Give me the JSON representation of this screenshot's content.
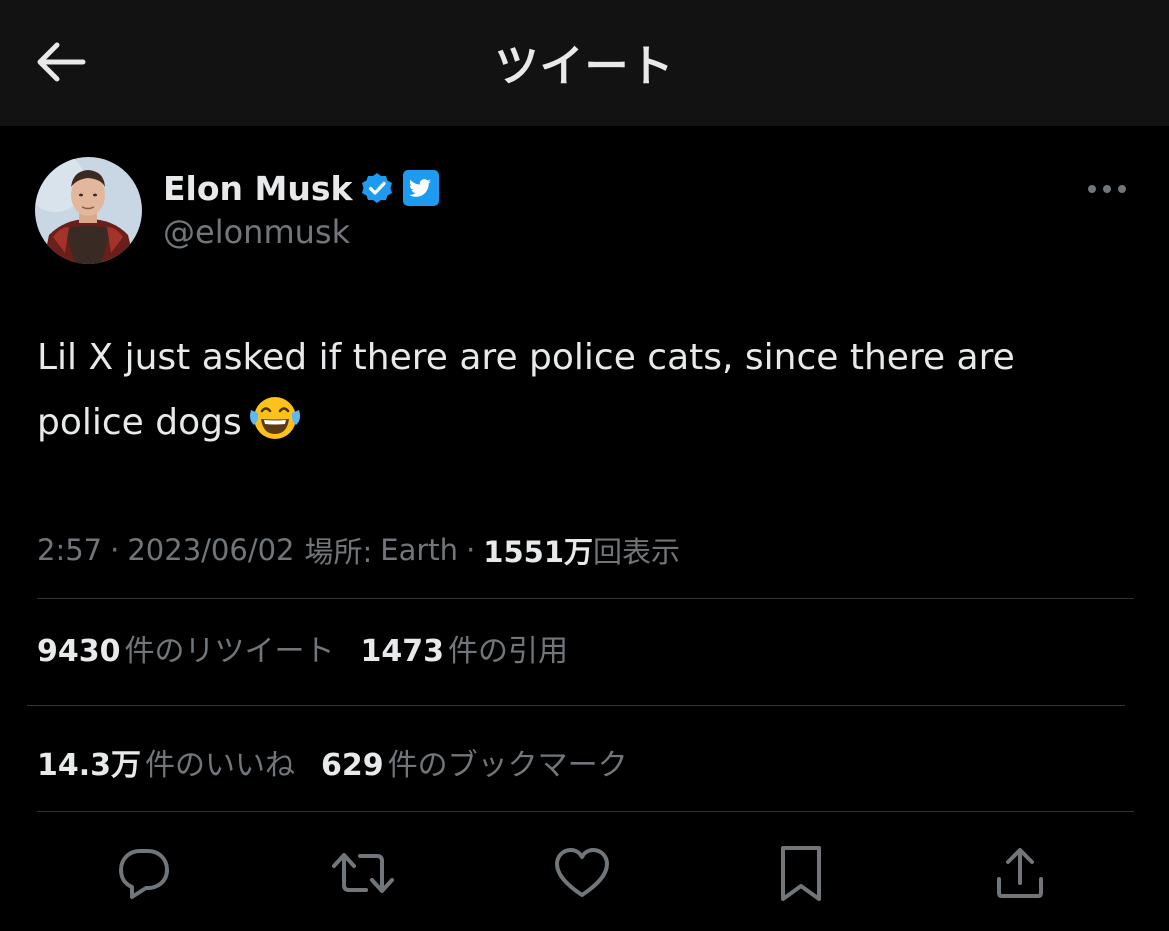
{
  "header": {
    "title": "ツイート"
  },
  "author": {
    "display_name": "Elon Musk",
    "handle": "@elonmusk",
    "verified_color": "#1d9bf0",
    "badge_color": "#1d9bf0"
  },
  "tweet": {
    "text": "Lil X just asked if there are police cats, since there are police dogs",
    "emoji": "face-with-tears-of-joy"
  },
  "meta": {
    "time": "2:57",
    "separator": "·",
    "date": "2023/06/02",
    "location_label": "場所:",
    "location": "Earth",
    "views_count": "1551万",
    "views_label": "回表示"
  },
  "stats_row1": [
    {
      "count": "9430",
      "label": "件のリツイート"
    },
    {
      "count": "1473",
      "label": "件の引用"
    }
  ],
  "stats_row2": [
    {
      "count": "14.3万",
      "label": "件のいいね"
    },
    {
      "count": "629",
      "label": "件のブックマーク"
    }
  ],
  "actions": [
    "reply-icon",
    "retweet-icon",
    "like-icon",
    "bookmark-icon",
    "share-icon"
  ]
}
